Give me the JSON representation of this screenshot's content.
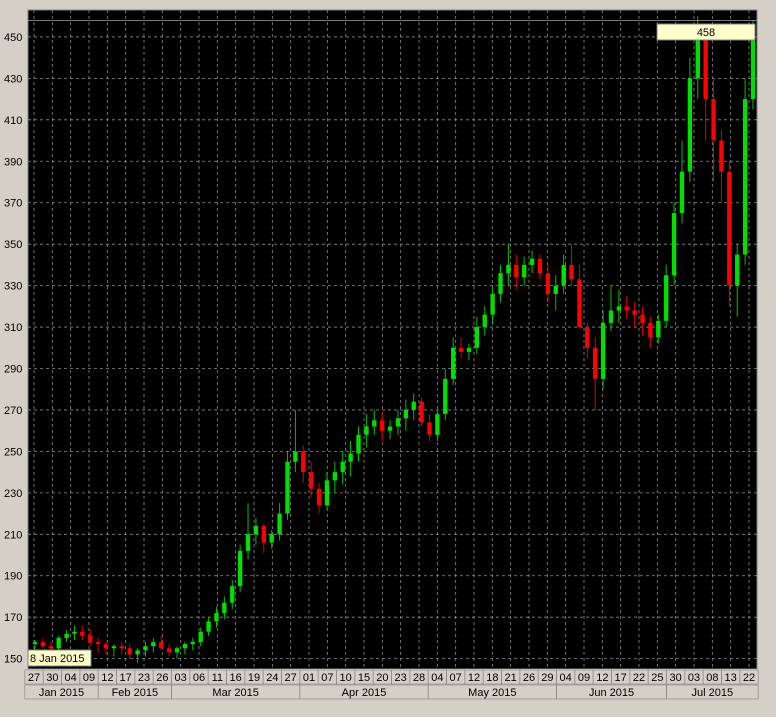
{
  "colors": {
    "background": "#000000",
    "frame": "#d4d0c8",
    "grid": "#8c8c8c",
    "up": "#00e000",
    "down": "#ff0000",
    "wick_up": "#00c000",
    "wick_down": "#e00000",
    "tooltip_bg": "#ffffcc",
    "axis_text": "#000000"
  },
  "crosshair": {
    "price_label": "458",
    "date_label": "8 Jan 2015",
    "price": 458
  },
  "chart_data": {
    "type": "candlestick",
    "title": "",
    "xlabel": "",
    "ylabel": "",
    "ylim": [
      145,
      463
    ],
    "y_ticks": [
      150,
      170,
      190,
      210,
      230,
      250,
      270,
      290,
      310,
      330,
      350,
      370,
      390,
      410,
      430,
      450
    ],
    "grid": true,
    "day_ticks": [
      "27",
      "30",
      "04",
      "09",
      "12",
      "17",
      "23",
      "26",
      "03",
      "06",
      "11",
      "16",
      "19",
      "24",
      "27",
      "01",
      "07",
      "10",
      "15",
      "20",
      "23",
      "28",
      "04",
      "07",
      "12",
      "18",
      "21",
      "26",
      "29",
      "04",
      "09",
      "12",
      "17",
      "22",
      "25",
      "30",
      "03",
      "08",
      "13",
      "22"
    ],
    "month_labels": [
      "Jan 2015",
      "Feb 2015",
      "Mar 2015",
      "Apr 2015",
      "May 2015",
      "Jun 2015",
      "Jul 2015"
    ],
    "candles": [
      [
        157,
        159,
        154,
        158
      ],
      [
        158,
        160,
        155,
        156
      ],
      [
        156,
        158,
        154,
        155
      ],
      [
        155,
        161,
        153,
        160
      ],
      [
        160,
        164,
        158,
        162
      ],
      [
        162,
        166,
        159,
        163
      ],
      [
        163,
        166,
        159,
        161
      ],
      [
        161,
        164,
        156,
        158
      ],
      [
        158,
        160,
        153,
        157
      ],
      [
        157,
        158,
        152,
        155
      ],
      [
        155,
        157,
        151,
        156
      ],
      [
        156,
        158,
        152,
        155
      ],
      [
        155,
        157,
        150,
        152
      ],
      [
        152,
        155,
        148,
        154
      ],
      [
        154,
        158,
        151,
        156
      ],
      [
        156,
        160,
        153,
        158
      ],
      [
        158,
        161,
        154,
        155
      ],
      [
        155,
        157,
        151,
        153
      ],
      [
        153,
        156,
        150,
        155
      ],
      [
        155,
        158,
        152,
        157
      ],
      [
        157,
        160,
        154,
        158
      ],
      [
        158,
        165,
        156,
        163
      ],
      [
        163,
        170,
        161,
        168
      ],
      [
        168,
        175,
        165,
        172
      ],
      [
        172,
        180,
        169,
        177
      ],
      [
        177,
        188,
        174,
        185
      ],
      [
        185,
        205,
        182,
        202
      ],
      [
        202,
        225,
        198,
        210
      ],
      [
        210,
        218,
        205,
        214
      ],
      [
        214,
        215,
        201,
        206
      ],
      [
        206,
        212,
        203,
        210
      ],
      [
        210,
        225,
        207,
        220
      ],
      [
        220,
        250,
        217,
        245
      ],
      [
        245,
        270,
        240,
        250
      ],
      [
        250,
        253,
        235,
        240
      ],
      [
        240,
        245,
        228,
        232
      ],
      [
        232,
        235,
        220,
        224
      ],
      [
        224,
        240,
        222,
        236
      ],
      [
        236,
        245,
        230,
        240
      ],
      [
        240,
        250,
        234,
        245
      ],
      [
        245,
        255,
        238,
        249
      ],
      [
        249,
        262,
        245,
        258
      ],
      [
        258,
        268,
        252,
        262
      ],
      [
        262,
        270,
        258,
        265
      ],
      [
        265,
        269,
        255,
        260
      ],
      [
        260,
        265,
        256,
        262
      ],
      [
        262,
        270,
        258,
        266
      ],
      [
        266,
        275,
        260,
        270
      ],
      [
        270,
        278,
        265,
        274
      ],
      [
        274,
        276,
        262,
        264
      ],
      [
        264,
        268,
        255,
        258
      ],
      [
        258,
        270,
        255,
        268
      ],
      [
        268,
        290,
        265,
        285
      ],
      [
        285,
        305,
        282,
        300
      ],
      [
        300,
        305,
        295,
        298
      ],
      [
        298,
        302,
        294,
        300
      ],
      [
        300,
        315,
        297,
        310
      ],
      [
        310,
        320,
        306,
        316
      ],
      [
        316,
        330,
        312,
        326
      ],
      [
        326,
        340,
        322,
        336
      ],
      [
        336,
        350,
        330,
        340
      ],
      [
        340,
        345,
        328,
        334
      ],
      [
        334,
        344,
        330,
        340
      ],
      [
        340,
        347,
        336,
        343
      ],
      [
        343,
        345,
        333,
        336
      ],
      [
        336,
        340,
        322,
        326
      ],
      [
        326,
        335,
        318,
        330
      ],
      [
        330,
        345,
        326,
        340
      ],
      [
        340,
        350,
        330,
        333
      ],
      [
        333,
        340,
        315,
        310
      ],
      [
        310,
        312,
        295,
        300
      ],
      [
        300,
        305,
        270,
        285
      ],
      [
        285,
        318,
        280,
        312
      ],
      [
        312,
        330,
        308,
        318
      ],
      [
        318,
        328,
        312,
        320
      ],
      [
        320,
        325,
        314,
        318
      ],
      [
        318,
        322,
        310,
        316
      ],
      [
        316,
        320,
        306,
        312
      ],
      [
        312,
        315,
        300,
        305
      ],
      [
        305,
        316,
        302,
        313
      ],
      [
        313,
        340,
        310,
        335
      ],
      [
        335,
        370,
        330,
        365
      ],
      [
        365,
        400,
        360,
        385
      ],
      [
        385,
        440,
        380,
        430
      ],
      [
        430,
        460,
        420,
        450
      ],
      [
        450,
        455,
        400,
        420
      ],
      [
        420,
        430,
        380,
        400
      ],
      [
        400,
        405,
        370,
        385
      ],
      [
        385,
        390,
        320,
        330
      ],
      [
        330,
        350,
        315,
        345
      ],
      [
        345,
        430,
        340,
        420
      ],
      [
        420,
        458,
        415,
        450
      ]
    ]
  }
}
